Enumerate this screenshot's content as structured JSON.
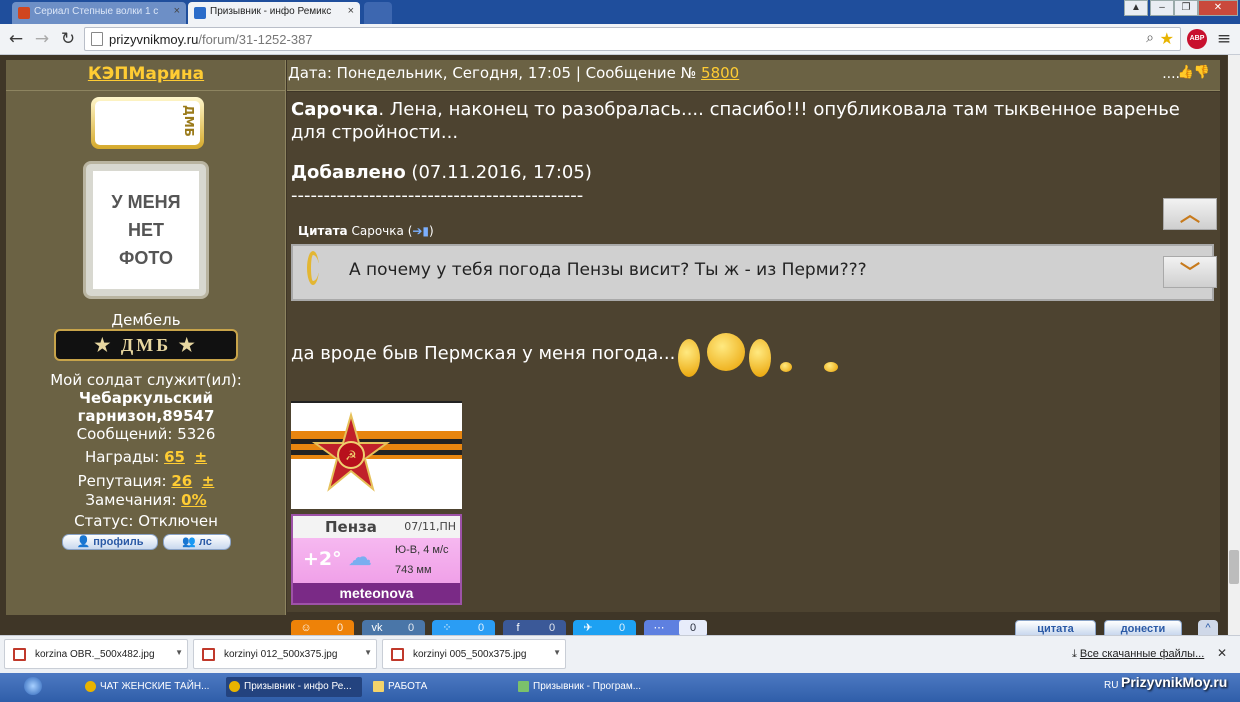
{
  "browser": {
    "tabs": [
      {
        "title": "Сериал Степные волки 1 с"
      },
      {
        "title": "Призывник - инфо Ремикс"
      }
    ],
    "url_host": "prizyvnikmoy.ru",
    "url_path": "/forum/31-1252-387",
    "window_buttons": [
      "–",
      "❐",
      "✕"
    ],
    "abp_label": "ABP"
  },
  "colors": {
    "accent": "#ffcc33",
    "sidebar": "#6b6244",
    "page": "#3f3627"
  },
  "sidebar": {
    "username": "КЭПМарина",
    "rank_badge_text": "ДМБ",
    "avatar_lines": [
      "У МЕНЯ",
      "НЕТ",
      "ФОТО"
    ],
    "rank": "Дембель",
    "rank_plaque": "★ ДМБ ★",
    "soldier_label": "Мой солдат служит(ил):",
    "soldier_place_1": "Чебаркульский",
    "soldier_place_2": "гарнизон,89547",
    "messages_label": "Сообщений:",
    "messages_value": "5326",
    "awards_label": "Награды:",
    "awards_value": "65",
    "reputation_label": "Репутация:",
    "reputation_value": "26",
    "plusminus": "±",
    "remarks_label": "Замечания:",
    "remarks_value": "0%",
    "status_label": "Статус:",
    "status_value": "Отключен",
    "profile_btn": "профиль",
    "pm_btn": "лс"
  },
  "post": {
    "header_text": "Дата: Понедельник, Сегодня, 17:05 | Сообщение №",
    "number": "5800",
    "dots": "....",
    "line1_bold": "Сарочка",
    "line1_rest": ". Лена, наконец то разобралась.... спасибо!!! опубликовала там тыквенное варенье",
    "line2": "для стройности...",
    "added_bold": "Добавлено",
    "added_date": " (07.11.2016, 17:05)",
    "separator": "---------------------------------------------",
    "quote_label": "Цитата",
    "quote_author": "Сарочка",
    "quote_text": "А почему у тебя погода Пензы висит? Ты ж - из Перми???",
    "reply_text": "да вроде быв Пермская у меня погода...",
    "weather": {
      "city": "Пенза",
      "date": "07/11,ПН",
      "temp": "+2°",
      "wind": "Ю-В, 4 м/с",
      "pressure": "743 мм",
      "brand": "meteonova"
    },
    "share_counts": [
      "0",
      "0",
      "0",
      "0",
      "0",
      "0"
    ],
    "quote_btn": "цитата",
    "report_btn": "донести"
  },
  "downloads": {
    "items": [
      "korzina OBR._500x482.jpg",
      "korzinyi 012_500x375.jpg",
      "korzinyi 005_500x375.jpg"
    ],
    "all": "Все скачанные файлы...",
    "close": "✕"
  },
  "taskbar": {
    "items": [
      "ЧАТ ЖЕНСКИЕ ТАЙН...",
      "Призывник - инфо Ре...",
      "РАБОТА",
      "Призывник - Програм..."
    ],
    "lang": "RU",
    "watermark": "PrizyvnikMoy.ru"
  }
}
